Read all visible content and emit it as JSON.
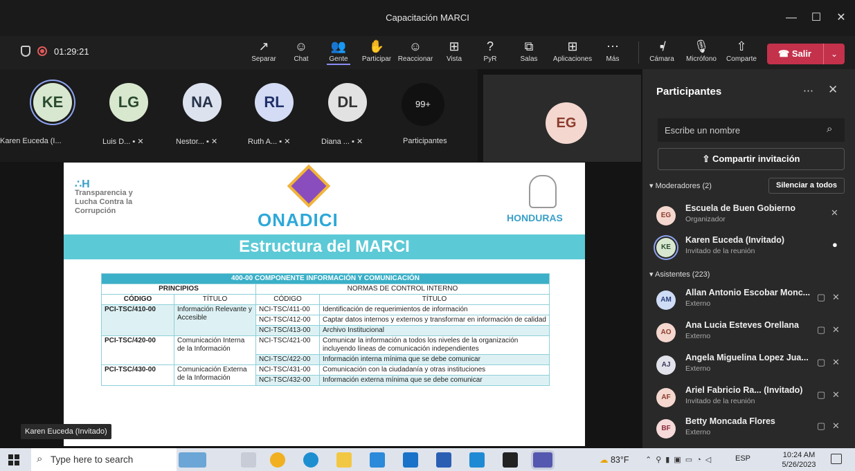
{
  "window": {
    "title": "Capacitación MARCI",
    "minimize": "—",
    "maximize": "☐",
    "close": "✕"
  },
  "meeting": {
    "timer": "01:29:21"
  },
  "toolbar": {
    "buttons": [
      {
        "label": "Separar",
        "icon": "↗"
      },
      {
        "label": "Chat",
        "icon": "☺"
      },
      {
        "label": "Gente",
        "icon": "👥"
      },
      {
        "label": "Participar",
        "icon": "✋"
      },
      {
        "label": "Reaccionar",
        "icon": "☺"
      },
      {
        "label": "Vista",
        "icon": "⊞"
      },
      {
        "label": "PyR",
        "icon": "?"
      },
      {
        "label": "Salas",
        "icon": "⧉"
      },
      {
        "label": "Aplicaciones",
        "icon": "⊞"
      },
      {
        "label": "Más",
        "icon": "⋯"
      }
    ],
    "camera": "Cámara",
    "mic": "Micrófono",
    "share": "Comparte",
    "leave": "Salir"
  },
  "gallery": {
    "tiles": [
      {
        "initials": "KE",
        "name": "Karen Euceda (I...",
        "color": "#d8e8d0"
      },
      {
        "initials": "LG",
        "name": "Luis D...",
        "color": "#d8e8cf"
      },
      {
        "initials": "NA",
        "name": "Nestor...",
        "color": "#dde3ee"
      },
      {
        "initials": "RL",
        "name": "Ruth A...",
        "color": "#d3dcf4"
      },
      {
        "initials": "DL",
        "name": "Diana ...",
        "color": "#e2e2e2"
      }
    ],
    "more_count": "99+",
    "more_label": "Participantes",
    "spotlight_initials": "EG"
  },
  "slide": {
    "logo_left": [
      "Transparencia y",
      "Lucha Contra la",
      "Corrupción"
    ],
    "logo_center": "ONADICI",
    "logo_right": "HONDURAS",
    "banner": "Estructura del MARCI",
    "table": {
      "title": "400-00 COMPONENTE INFORMACIÓN Y COMUNICACIÓN",
      "group_principios": "PRINCIPIOS",
      "group_normas": "NORMAS DE CONTROL INTERNO",
      "col_codigo": "CÓDIGO",
      "col_titulo": "TÍTULO",
      "rows": [
        {
          "p_code": "PCI-TSC/410-00",
          "p_title": "Información Relevante y Accesible",
          "norms": [
            {
              "code": "NCI-TSC/411-00",
              "title": "Identificación de requerimientos de información"
            },
            {
              "code": "NCI-TSC/412-00",
              "title": "Captar datos internos y externos y transformar en información de calidad"
            },
            {
              "code": "NCI-TSC/413-00",
              "title": "Archivo Institucional"
            }
          ]
        },
        {
          "p_code": "PCI-TSC/420-00",
          "p_title": "Comunicación Interna de la Información",
          "norms": [
            {
              "code": "NCI-TSC/421-00",
              "title": "Comunicar la información a todos los niveles de la organización incluyendo líneas de comunicación independientes"
            },
            {
              "code": "NCI-TSC/422-00",
              "title": "Información interna mínima que se debe comunicar"
            }
          ]
        },
        {
          "p_code": "PCI-TSC/430-00",
          "p_title": "Comunicación Externa de la Información",
          "norms": [
            {
              "code": "NCI-TSC/431-00",
              "title": "Comunicación con la ciudadanía y otras instituciones"
            },
            {
              "code": "NCI-TSC/432-00",
              "title": "Información externa mínima que se debe comunicar"
            }
          ]
        }
      ]
    }
  },
  "speaker_tag": "Karen Euceda (Invitado)",
  "panel": {
    "title": "Participantes",
    "search_placeholder": "Escribe un nombre",
    "invite": "Compartir invitación",
    "moderators_label": "Moderadores (2)",
    "mute_all": "Silenciar a todos",
    "attendees_label": "Asistentes (223)",
    "moderators": [
      {
        "initials": "EG",
        "name": "Escuela de Buen Gobierno",
        "role": "Organizador",
        "color": "#f4d7cf",
        "text": "#8b3c2c"
      },
      {
        "initials": "KE",
        "name": "Karen Euceda (Invitado)",
        "role": "Invitado de la reunión",
        "color": "#d8e8d0",
        "text": "#2a4a30"
      }
    ],
    "attendees": [
      {
        "initials": "AM",
        "name": "Allan Antonio Escobar Monc...",
        "role": "Externo",
        "color": "#cfdcf6",
        "text": "#2b3f7a"
      },
      {
        "initials": "AO",
        "name": "Ana Lucia Esteves Orellana",
        "role": "Externo",
        "color": "#f4d7cf",
        "text": "#8b3c2c"
      },
      {
        "initials": "AJ",
        "name": "Angela Miguelina Lopez Jua...",
        "role": "Externo",
        "color": "#e2e2ea",
        "text": "#3a3a5a"
      },
      {
        "initials": "AF",
        "name": "Ariel Fabricio Ra... (Invitado)",
        "role": "Invitado de la reunión",
        "color": "#f4d7cf",
        "text": "#8b3c2c"
      },
      {
        "initials": "BF",
        "name": "Betty Moncada Flores",
        "role": "Externo",
        "color": "#f6d9d9",
        "text": "#8b2c3c"
      }
    ]
  },
  "taskbar": {
    "search_placeholder": "Type here to search",
    "weather": "83°F",
    "lang": "ESP",
    "time": "10:24 AM",
    "date": "5/26/2023"
  }
}
